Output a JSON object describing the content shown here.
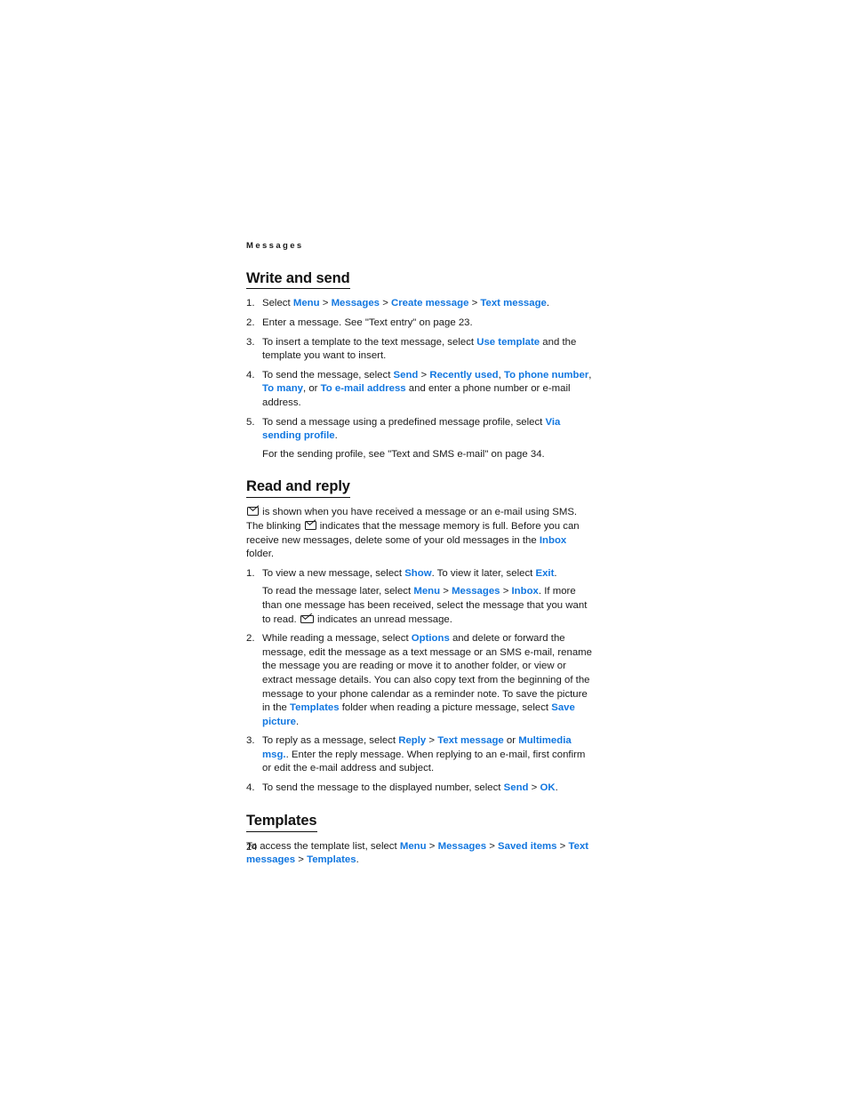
{
  "document": {
    "running_header": "Messages",
    "page_number": "24"
  },
  "icons": {
    "envelope": "envelope-icon",
    "envelope_unread": "envelope-unread-icon"
  },
  "colors": {
    "link": "#1277e0",
    "text": "#1a1a1a",
    "background": "#ffffff"
  },
  "sections": {
    "write_and_send": {
      "heading": "Write and send",
      "steps": [
        {
          "number": "1.",
          "parts": [
            {
              "t": "Select "
            },
            {
              "t": "Menu",
              "link": true
            },
            {
              "t": " > ",
              "gt": true
            },
            {
              "t": "Messages",
              "link": true
            },
            {
              "t": " > ",
              "gt": true
            },
            {
              "t": "Create message",
              "link": true
            },
            {
              "t": " > ",
              "gt": true
            },
            {
              "t": "Text message",
              "link": true
            },
            {
              "t": "."
            }
          ],
          "plain": "Select Menu > Messages > Create message > Text message."
        },
        {
          "number": "2.",
          "plain": "Enter a message. See \"Text entry\" on page 23."
        },
        {
          "number": "3.",
          "plain": "To insert a template to the text message, select Use template and the template you want to insert."
        },
        {
          "number": "4.",
          "plain": "To send the message, select Send > Recently used, To phone number, To many, or To e-mail address and enter a phone number or e-mail address."
        },
        {
          "number": "5.",
          "plain": "To send a message using a predefined message profile, select Via sending profile.",
          "continuation": "For the sending profile, see \"Text and SMS e-mail\" on page 34."
        }
      ]
    },
    "read_and_reply": {
      "heading": "Read and reply",
      "intro": "is shown when you have received a message or an e-mail using SMS. The blinking indicates that the message memory is full. Before you can receive new messages, delete some of your old messages in the Inbox folder.",
      "steps": [
        {
          "number": "1.",
          "plain": "To view a new message, select Show. To view it later, select Exit.",
          "continuation": "To read the message later, select Menu > Messages > Inbox. If more than one message has been received, select the message that you want to read. indicates an unread message."
        },
        {
          "number": "2.",
          "plain": "While reading a message, select Options and delete or forward the message, edit the message as a text message or an SMS e-mail, rename the message you are reading or move it to another folder, or view or extract message details. You can also copy text from the beginning of the message to your phone calendar as a reminder note. To save the picture in the Templates folder when reading a picture message, select Save picture."
        },
        {
          "number": "3.",
          "plain": "To reply as a message, select Reply > Text message or Multimedia msg.. Enter the reply message. When replying to an e-mail, first confirm or edit the e-mail address and subject."
        },
        {
          "number": "4.",
          "plain": "To send the message to the displayed number, select Send > OK."
        }
      ]
    },
    "templates": {
      "heading": "Templates",
      "body": "To access the template list, select Menu > Messages > Saved items > Text messages > Templates."
    }
  },
  "text_fragments": {
    "s1_select": "Select ",
    "s1_menu": "Menu",
    "s1_messages": "Messages",
    "s1_create_message": "Create message",
    "s1_text_message": "Text message",
    "s1_period": ".",
    "s2_full": "Enter a message. See \"Text entry\" on page 23.",
    "s3_a": "To insert a template to the text message, select ",
    "s3_use_template": "Use template",
    "s3_b": " and the template you want to insert.",
    "s4_a": "To send the message, select ",
    "s4_send": "Send",
    "s4_recently_used": "Recently used",
    "s4_to_phone_number": "To phone number",
    "s4_to_many": "To many",
    "s4_or": ", or ",
    "s4_to_email": "To e-mail address",
    "s4_b": " and enter a phone number or e-mail address.",
    "s4_comma": ", ",
    "s5_a": "To send a message using a predefined message profile, select ",
    "s5_via": "Via sending profile",
    "s5_period": ".",
    "s5_cont": "For the sending profile, see \"Text and SMS e-mail\" on page 34.",
    "rr_a": " is shown when you have received a message or an e-mail using SMS. The blinking ",
    "rr_b": " indicates that the message memory is full. Before you can receive new messages, delete some of your old messages in the ",
    "rr_inbox": "Inbox",
    "rr_c": " folder.",
    "r1_a": "To view a new message, select ",
    "r1_show": "Show",
    "r1_b": ". To view it later, select ",
    "r1_exit": "Exit",
    "r1_c": ".",
    "r1_cont_a": "To read the message later, select ",
    "r1_menu": "Menu",
    "r1_messages": "Messages",
    "r1_inbox": "Inbox",
    "r1_cont_b": ". If more than one message has been received, select the message that you want to read. ",
    "r1_cont_c": " indicates an unread message.",
    "r2_a": "While reading a message, select ",
    "r2_options": "Options",
    "r2_b": " and delete or forward the message, edit the message as a text message or an SMS e-mail, rename the message you are reading or move it to another folder, or view or extract message details. You can also copy text from the beginning of the message to your phone calendar as a reminder note. To save the picture in the ",
    "r2_templates": "Templates",
    "r2_c": " folder when reading a picture message, select ",
    "r2_save_picture": "Save picture",
    "r2_d": ".",
    "r3_a": "To reply as a message, select ",
    "r3_reply": "Reply",
    "r3_text_message": "Text message",
    "r3_or": " or ",
    "r3_multimedia": "Multimedia msg.",
    "r3_b": ". Enter the reply message. When replying to an e-mail, first confirm or edit the e-mail address and subject.",
    "r4_a": "To send the message to the displayed number, select ",
    "r4_send": "Send",
    "r4_ok": "OK",
    "r4_b": ".",
    "tpl_a": "To access the template list, select ",
    "tpl_menu": "Menu",
    "tpl_messages": "Messages",
    "tpl_saved_items": "Saved items",
    "tpl_text_messages": "Text messages",
    "tpl_templates": "Templates",
    "tpl_b": ".",
    "gt": " > "
  }
}
